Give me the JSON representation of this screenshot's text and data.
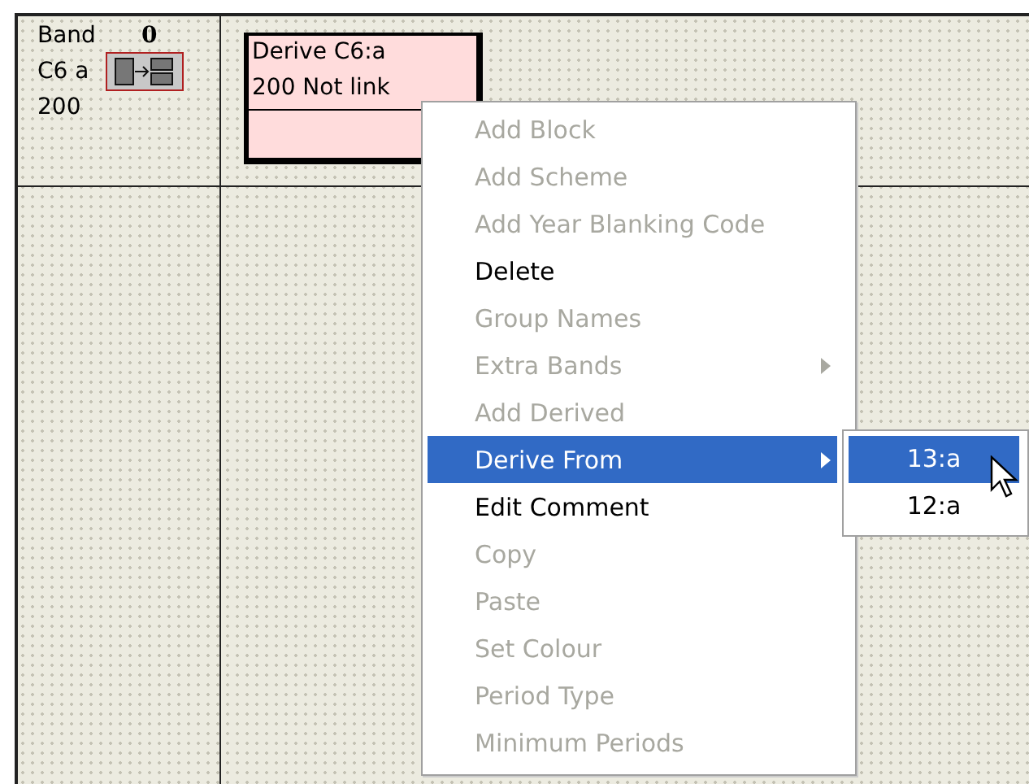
{
  "band_cell": {
    "label": "Band",
    "count": "0",
    "code": "C6 a",
    "value": "200"
  },
  "block": {
    "title": "Derive C6:a",
    "status": "200  Not link"
  },
  "context_menu": {
    "items": [
      {
        "label": "Add Block",
        "disabled": true,
        "selected": false,
        "has_submenu": false
      },
      {
        "label": "Add Scheme",
        "disabled": true,
        "selected": false,
        "has_submenu": false
      },
      {
        "label": "Add Year Blanking Code",
        "disabled": true,
        "selected": false,
        "has_submenu": false
      },
      {
        "label": "Delete",
        "disabled": false,
        "selected": false,
        "has_submenu": false
      },
      {
        "label": "Group Names",
        "disabled": true,
        "selected": false,
        "has_submenu": false
      },
      {
        "label": "Extra Bands",
        "disabled": true,
        "selected": false,
        "has_submenu": true
      },
      {
        "label": "Add Derived",
        "disabled": true,
        "selected": false,
        "has_submenu": false
      },
      {
        "label": "Derive From",
        "disabled": false,
        "selected": true,
        "has_submenu": true
      },
      {
        "label": "Edit Comment",
        "disabled": false,
        "selected": false,
        "has_submenu": false
      },
      {
        "label": "Copy",
        "disabled": true,
        "selected": false,
        "has_submenu": false
      },
      {
        "label": "Paste",
        "disabled": true,
        "selected": false,
        "has_submenu": false
      },
      {
        "label": "Set Colour",
        "disabled": true,
        "selected": false,
        "has_submenu": false
      },
      {
        "label": "Period Type",
        "disabled": true,
        "selected": false,
        "has_submenu": false
      },
      {
        "label": "Minimum Periods",
        "disabled": true,
        "selected": false,
        "has_submenu": false
      }
    ]
  },
  "submenu": {
    "items": [
      {
        "label": "13:a",
        "selected": true
      },
      {
        "label": "12:a",
        "selected": false
      }
    ]
  }
}
